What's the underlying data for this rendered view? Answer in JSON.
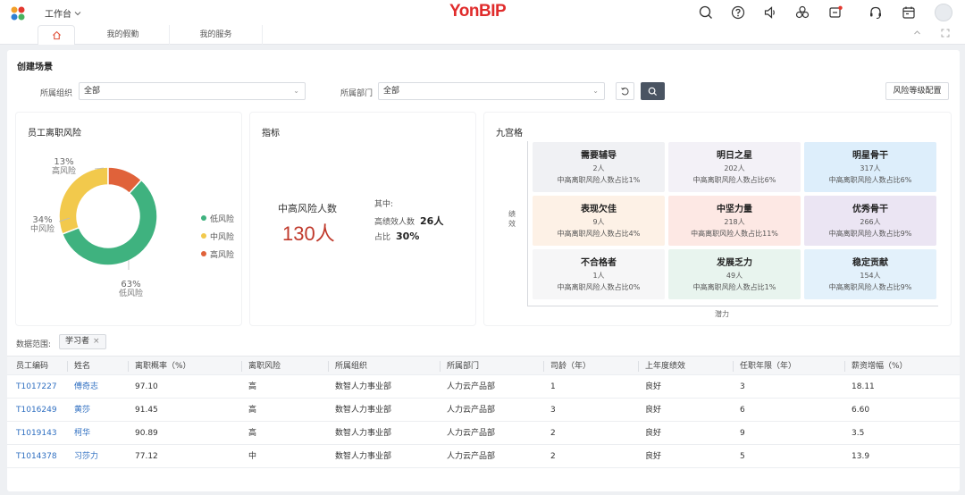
{
  "header": {
    "workspace": "工作台",
    "brand": "YonBIP"
  },
  "tabs": [
    {
      "label": "我的假勤"
    },
    {
      "label": "我的服务"
    }
  ],
  "page": {
    "title": "创建场景"
  },
  "filters": {
    "org_label": "所属组织",
    "org_value": "全部",
    "dept_label": "所属部门",
    "dept_value": "全部",
    "config_button": "风险等级配置"
  },
  "risk_card": {
    "title": "员工离职风险",
    "legend": [
      {
        "label": "低风险",
        "color": "#3fb27f"
      },
      {
        "label": "中风险",
        "color": "#f2c94c"
      },
      {
        "label": "高风险",
        "color": "#e0623a"
      }
    ],
    "labels": {
      "high": {
        "pct": "13%",
        "name": "高风险"
      },
      "mid": {
        "pct": "34%",
        "name": "中风险"
      },
      "low": {
        "pct": "63%",
        "name": "低风险"
      }
    }
  },
  "chart_data": {
    "type": "pie",
    "categories": [
      "低风险",
      "中风险",
      "高风险"
    ],
    "values": [
      63,
      34,
      13
    ],
    "colors": [
      "#3fb27f",
      "#f2c94c",
      "#e0623a"
    ],
    "title": "员工离职风险",
    "legend": "right",
    "donut": true
  },
  "indicator_card": {
    "title": "指标",
    "main_label": "中高风险人数",
    "main_value": "130人",
    "side_title": "其中:",
    "high_perf_label": "高绩效人数",
    "high_perf_value": "26人",
    "ratio_label": "占比",
    "ratio_value": "30%"
  },
  "nine_grid": {
    "title": "九宫格",
    "y_axis": "绩效",
    "x_axis": "潜力",
    "cells": [
      {
        "title": "需要辅导",
        "count": "2人",
        "ratio": "中高离职风险人数占比1%",
        "bg": "#f0f1f4"
      },
      {
        "title": "明日之星",
        "count": "202人",
        "ratio": "中高离职风险人数占比6%",
        "bg": "#f3f1f7"
      },
      {
        "title": "明星骨干",
        "count": "317人",
        "ratio": "中高离职风险人数占比6%",
        "bg": "#ddeefb"
      },
      {
        "title": "表现欠佳",
        "count": "9人",
        "ratio": "中高离职风险人数占比4%",
        "bg": "#fdf1e6"
      },
      {
        "title": "中坚力量",
        "count": "218人",
        "ratio": "中高离职风险人数占比11%",
        "bg": "#fde8e4"
      },
      {
        "title": "优秀骨干",
        "count": "266人",
        "ratio": "中高离职风险人数占比9%",
        "bg": "#ebe5f3"
      },
      {
        "title": "不合格者",
        "count": "1人",
        "ratio": "中高离职风险人数占比0%",
        "bg": "#f6f6f7"
      },
      {
        "title": "发展乏力",
        "count": "49人",
        "ratio": "中高离职风险人数占比1%",
        "bg": "#e8f4ee"
      },
      {
        "title": "稳定贡献",
        "count": "154人",
        "ratio": "中高离职风险人数占比9%",
        "bg": "#e3f1fb"
      }
    ]
  },
  "data_range": {
    "label": "数据范围:",
    "tag": "学习者"
  },
  "table": {
    "columns": [
      "员工编码",
      "姓名",
      "离职概率（%）",
      "离职风险",
      "所属组织",
      "所属部门",
      "司龄（年）",
      "上年度绩效",
      "任职年限（年）",
      "薪资增幅（%）"
    ],
    "rows": [
      [
        "T1017227",
        "傅奇志",
        "97.10",
        "高",
        "数智人力事业部",
        "人力云产品部",
        "1",
        "良好",
        "3",
        "18.11"
      ],
      [
        "T1016249",
        "黄莎",
        "91.45",
        "高",
        "数智人力事业部",
        "人力云产品部",
        "3",
        "良好",
        "6",
        "6.60"
      ],
      [
        "T1019143",
        "柯华",
        "90.89",
        "高",
        "数智人力事业部",
        "人力云产品部",
        "2",
        "良好",
        "9",
        "3.5"
      ],
      [
        "T1014378",
        "习莎力",
        "77.12",
        "中",
        "数智人力事业部",
        "人力云产品部",
        "2",
        "良好",
        "5",
        "13.9"
      ]
    ]
  }
}
